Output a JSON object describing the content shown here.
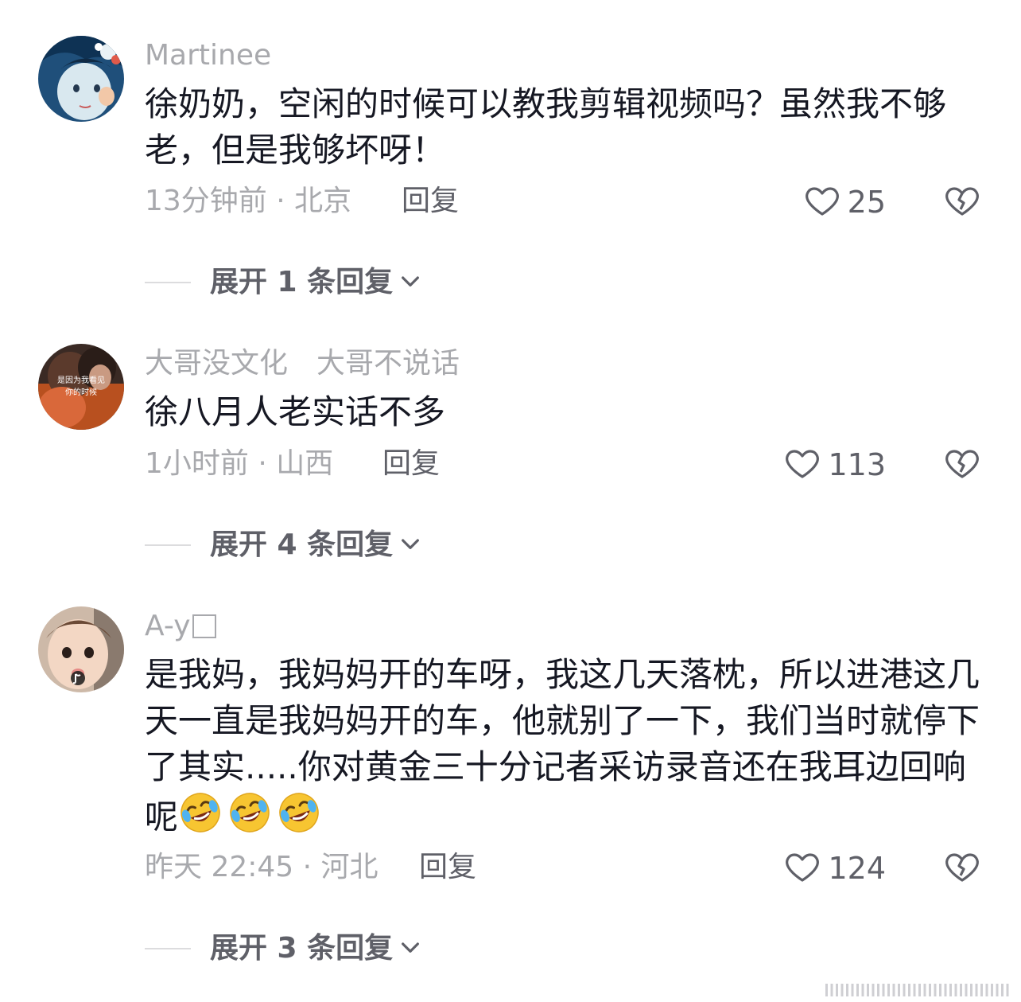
{
  "comments": [
    {
      "username": "Martinee",
      "text": "徐奶奶，空闲的时候可以教我剪辑视频吗？虽然我不够老，但是我够坏呀！",
      "meta": "13分钟前 · 北京",
      "reply_label": "回复",
      "likes": "25",
      "expand_label": "展开 1 条回复"
    },
    {
      "username": "大哥没文化　大哥不说话",
      "avatar_caption_1": "是因为我看见",
      "avatar_caption_2": "你的时候",
      "text": "徐八月人老实话不多",
      "meta": "1小时前 · 山西",
      "reply_label": "回复",
      "likes": "113",
      "expand_label": "展开 4 条回复"
    },
    {
      "username": "A-y",
      "text": "是我妈，我妈妈开的车呀，我这几天落枕，所以进港这几天一直是我妈妈开的车，他就别了一下，我们当时就停下了其实.....你对黄金三十分记者采访录音还在我耳边回响呢",
      "emojis": [
        "rofl-emoji",
        "rofl-emoji",
        "rofl-emoji"
      ],
      "meta": "昨天 22:45 · 河北",
      "reply_label": "回复",
      "likes": "124",
      "expand_label": "展开 3 条回复"
    }
  ],
  "icons": {
    "like": "heart-outline-icon",
    "dislike": "broken-heart-icon",
    "expand": "chevron-down-icon"
  },
  "colors": {
    "text_primary": "#161823",
    "text_secondary": "#a8a9ad",
    "text_action": "#5f6068"
  }
}
